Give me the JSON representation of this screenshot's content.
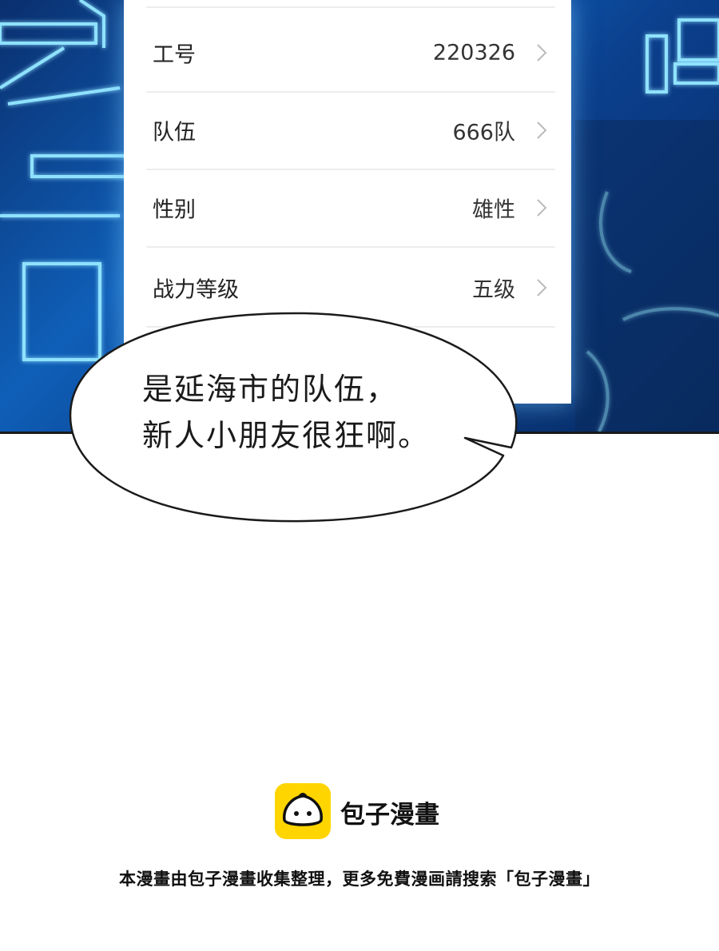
{
  "profile": {
    "rows": [
      {
        "label": "工号",
        "value": "220326"
      },
      {
        "label": "队伍",
        "value": "666队"
      },
      {
        "label": "性别",
        "value": "雄性"
      },
      {
        "label": "战力等级",
        "value": "五级"
      }
    ]
  },
  "speech": {
    "line1": "是延海市的队伍，",
    "line2": "新人小朋友很狂啊。"
  },
  "watermark": {
    "brand": "包子漫畫",
    "footer": "本漫畫由包子漫畫收集整理，更多免費漫画請搜索「包子漫畫」"
  },
  "colors": {
    "glow": "#6fd3ff",
    "logo_yellow": "#ffd500",
    "background_blue": "#0f5fb8"
  }
}
